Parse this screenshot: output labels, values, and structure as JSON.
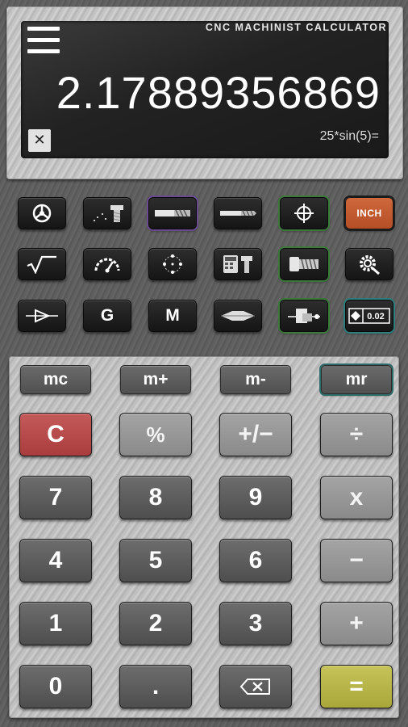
{
  "display": {
    "app_title": "CNC MACHINIST CALCULATOR",
    "result": "2.17889356869",
    "expression": "25*sin(5)=",
    "clear_label": "✕"
  },
  "function_rows": [
    [
      {
        "name": "steering-wheel-icon"
      },
      {
        "name": "thread-cutting-icon"
      },
      {
        "name": "end-mill-icon"
      },
      {
        "name": "drill-bit-icon"
      },
      {
        "name": "crosshair-icon"
      },
      {
        "name": "inch-toggle",
        "label": "INCH",
        "accent": "#c85c32"
      }
    ],
    [
      {
        "name": "square-root-icon"
      },
      {
        "name": "speedometer-icon"
      },
      {
        "name": "bolt-circle-icon"
      },
      {
        "name": "calculator-bolt-icon"
      },
      {
        "name": "screw-icon"
      },
      {
        "name": "gear-search-icon"
      }
    ],
    [
      {
        "name": "taper-icon"
      },
      {
        "name": "g-code",
        "label": "G"
      },
      {
        "name": "m-code",
        "label": "M"
      },
      {
        "name": "chamfer-icon"
      },
      {
        "name": "tool-holder-icon"
      },
      {
        "name": "tolerance-icon",
        "label": "0.02"
      }
    ]
  ],
  "memory": {
    "mc": "mc",
    "m_plus": "m+",
    "m_minus": "m-",
    "mr": "mr"
  },
  "keys": {
    "clear": "C",
    "percent": "%",
    "plus_minus": "+/−",
    "divide": "÷",
    "seven": "7",
    "eight": "8",
    "nine": "9",
    "multiply": "x",
    "four": "4",
    "five": "5",
    "six": "6",
    "minus": "−",
    "one": "1",
    "two": "2",
    "three": "3",
    "plus": "+",
    "zero": "0",
    "decimal": ".",
    "equals": "="
  },
  "colors": {
    "clear_key": "#b84a4a",
    "equals_key": "#b8b648",
    "inch_key": "#c85c32",
    "display_bg": "#222222"
  }
}
